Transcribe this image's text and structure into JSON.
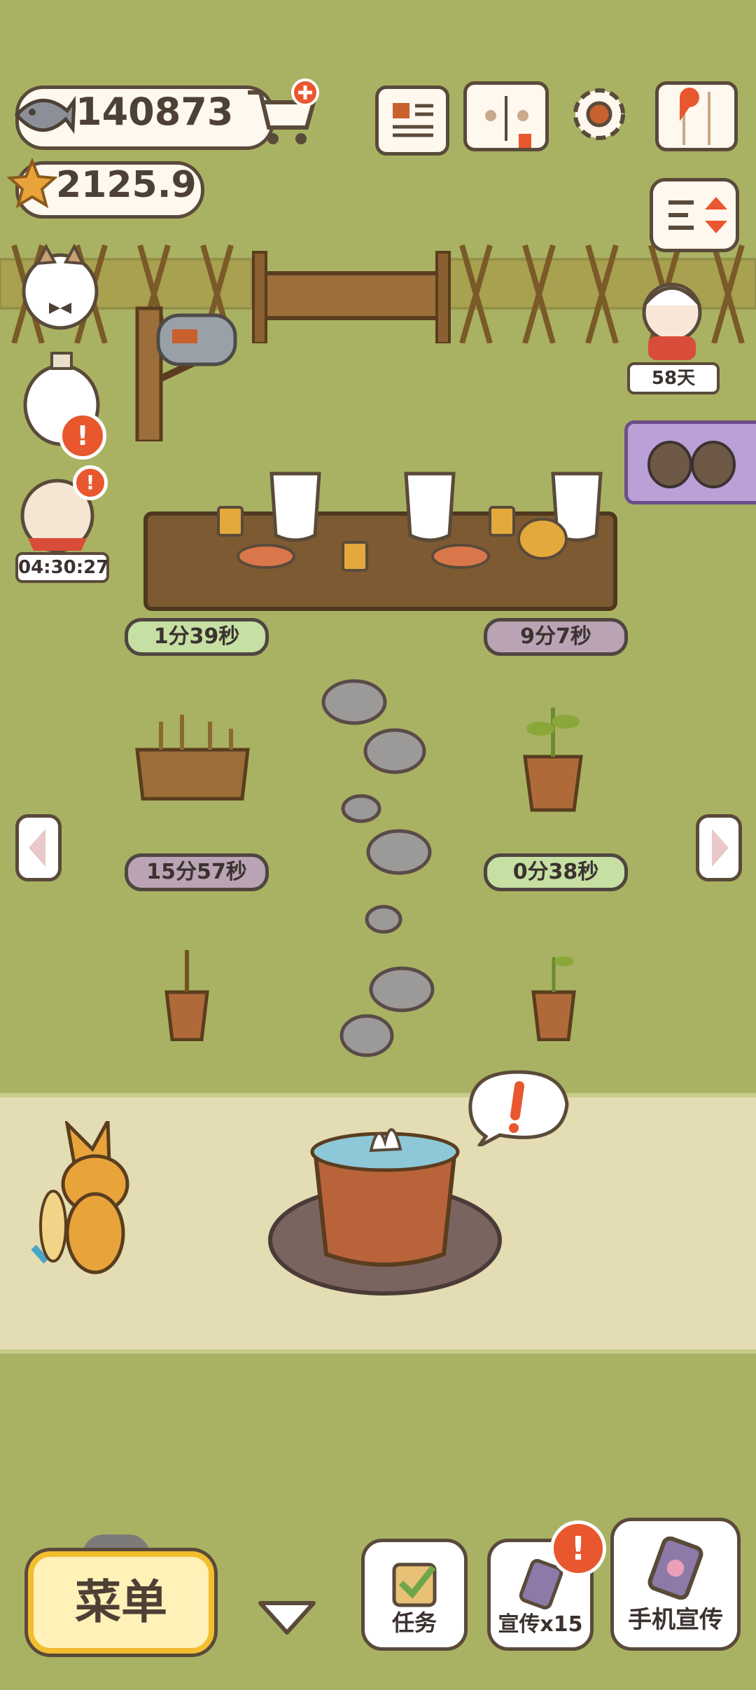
{
  "hud": {
    "fish_count": "140873",
    "star_count": "2125.9",
    "days_label": "58天",
    "cat_timer": "04:30:27"
  },
  "timers": {
    "slot_1": "1分39秒",
    "slot_2": "9分7秒",
    "slot_3": "15分57秒",
    "slot_4": "0分38秒"
  },
  "bottom_bar": {
    "menu_label": "菜单",
    "task_label": "任务",
    "promo15_label": "宣传x15",
    "phone_promo_label": "手机宣传"
  },
  "icons": {
    "fish": "fish-icon",
    "star": "star-icon",
    "cart": "cart-add-icon",
    "news": "newspaper-icon",
    "book": "pawprint-book-icon",
    "gear": "gear-icon",
    "map": "map-icon",
    "sort": "sort-icon"
  },
  "colors": {
    "grass": "#a9b262",
    "path": "#e4dcb2",
    "timer_green": "#c6dfa3",
    "timer_gray": "#b9a3b4",
    "alert": "#e9572e",
    "menu_gold": "#f2bd2e"
  }
}
